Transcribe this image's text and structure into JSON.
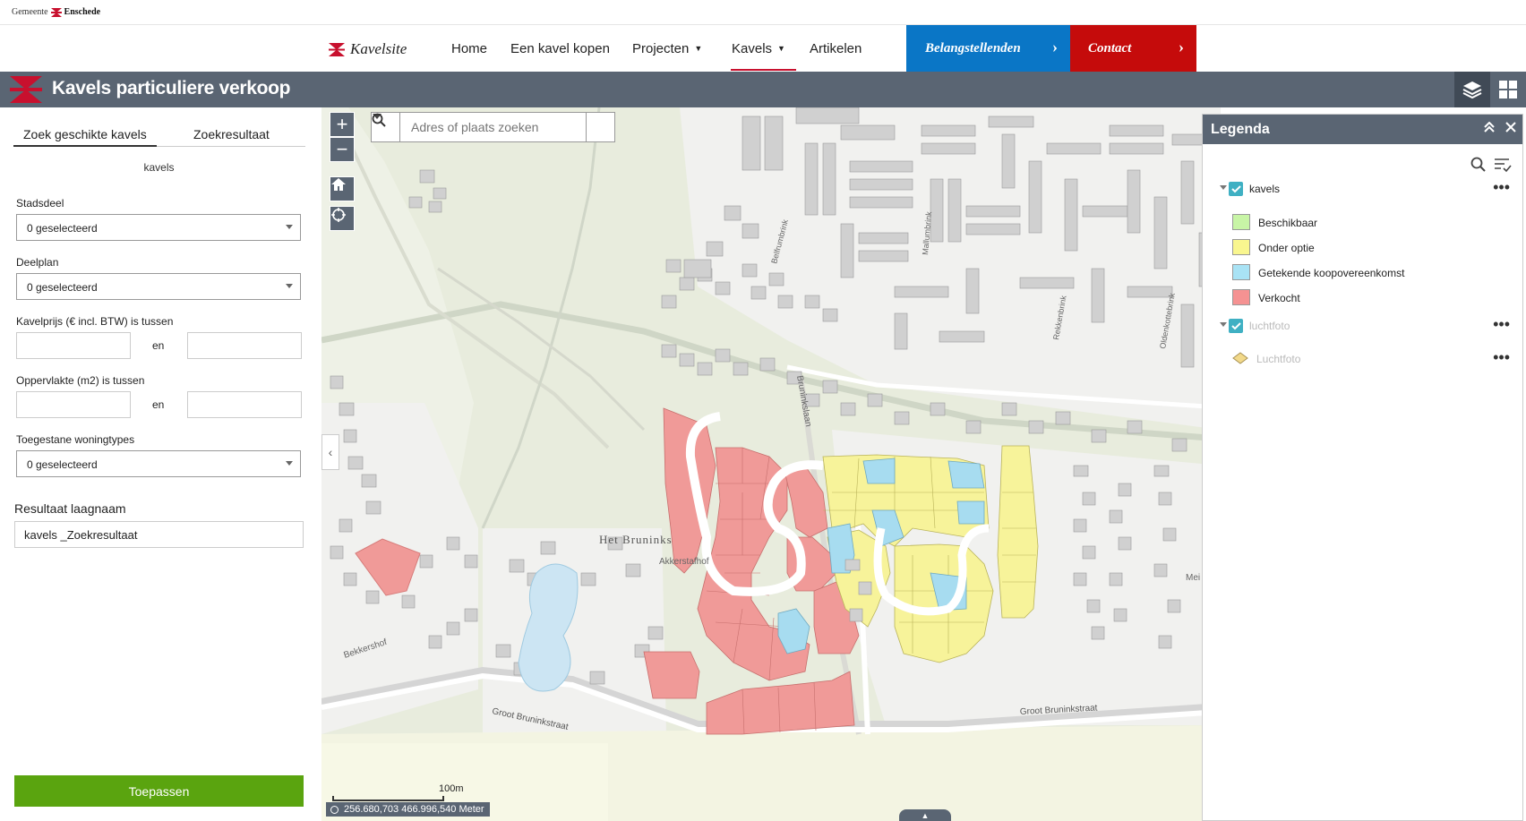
{
  "top": {
    "brand_prefix": "Gemeente",
    "brand_name": "Enschede"
  },
  "nav": {
    "site": "Kavelsite",
    "items": [
      {
        "label": "Home"
      },
      {
        "label": "Een kavel kopen"
      },
      {
        "label": "Projecten"
      },
      {
        "label": "Kavels"
      },
      {
        "label": "Artikelen"
      }
    ],
    "cta1": "Belangstellenden",
    "cta2": "Contact"
  },
  "app": {
    "title": "Kavels particuliere verkoop"
  },
  "panel": {
    "tabs": [
      {
        "label": "Zoek geschikte kavels"
      },
      {
        "label": "Zoekresultaat"
      }
    ],
    "layer": "kavels",
    "fields": [
      {
        "label": "Stadsdeel",
        "value": "0  geselecteerd"
      },
      {
        "label": "Deelplan",
        "value": "0  geselecteerd"
      },
      {
        "label": "Kavelprijs (€ incl. BTW) is tussen",
        "sep": "en"
      },
      {
        "label": "Oppervlakte (m2) is tussen",
        "sep": "en"
      },
      {
        "label": "Toegestane woningtypes",
        "value": "0  geselecteerd"
      }
    ],
    "result_label": "Resultaat laagnaam",
    "result_value": "kavels _Zoekresultaat",
    "apply": "Toepassen"
  },
  "map": {
    "search_placeholder": "Adres of plaats zoeken",
    "zoom_in": "+",
    "zoom_out": "−",
    "scale": "100m",
    "coords": "256.680,703 466.996,540 Meter",
    "labels": {
      "bruninks": "Het Bruninks",
      "akkerstaf": "Akkerstafhof",
      "bruninkslaan": "Bruninkslaan",
      "bekkershof": "Bekkershof",
      "groot1": "Groot Bruninkstraat",
      "groot2": "Groot Bruninkstraat",
      "belfrum": "Belfrumbrink",
      "mallum": "Mallumbrink",
      "rekken": "Rekkenbrink",
      "olden": "Oldenkottebrink",
      "mei": "Mei"
    }
  },
  "legend": {
    "title": "Legenda",
    "layers": [
      {
        "name": "kavels",
        "items": [
          {
            "label": "Beschikbaar",
            "color": "#c8f5a6"
          },
          {
            "label": "Onder optie",
            "color": "#f9f68f"
          },
          {
            "label": "Getekende koopovereenkomst",
            "color": "#a9e3f5"
          },
          {
            "label": "Verkocht",
            "color": "#f59292"
          }
        ]
      },
      {
        "name": "luchtfoto",
        "items": [
          {
            "label": "Luchtfoto",
            "color": "#f2d98a"
          }
        ]
      }
    ]
  },
  "colors": {
    "header": "#5a6573",
    "blue": "#0a76c6",
    "red": "#c50b0b",
    "green": "#5aa40f",
    "sold": "#f09a98",
    "option": "#f7f39a",
    "signed": "#a7dcf0"
  }
}
